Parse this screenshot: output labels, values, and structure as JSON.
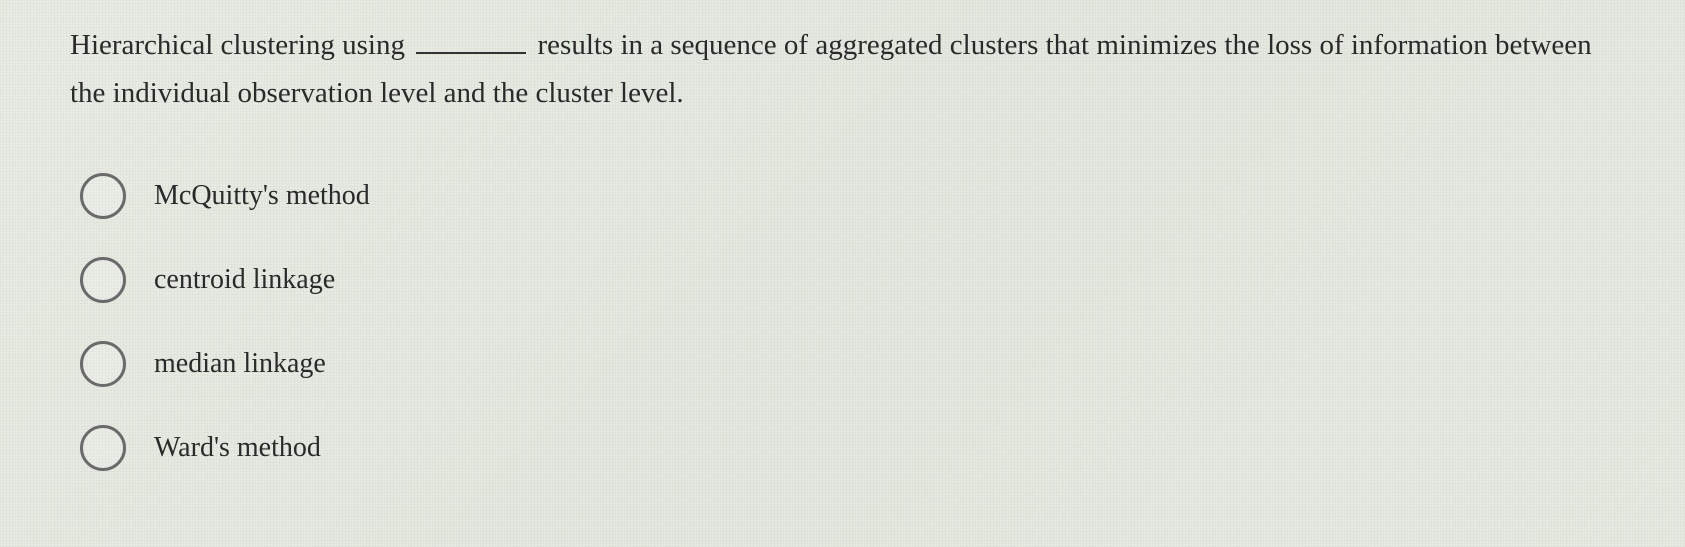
{
  "question": {
    "part1": "Hierarchical clustering using ",
    "part2": " results in a sequence of aggregated clusters that minimizes the loss of information between the individual observation level and the cluster level."
  },
  "options": [
    {
      "label": "McQuitty's method"
    },
    {
      "label": "centroid linkage"
    },
    {
      "label": "median linkage"
    },
    {
      "label": "Ward's method"
    }
  ]
}
